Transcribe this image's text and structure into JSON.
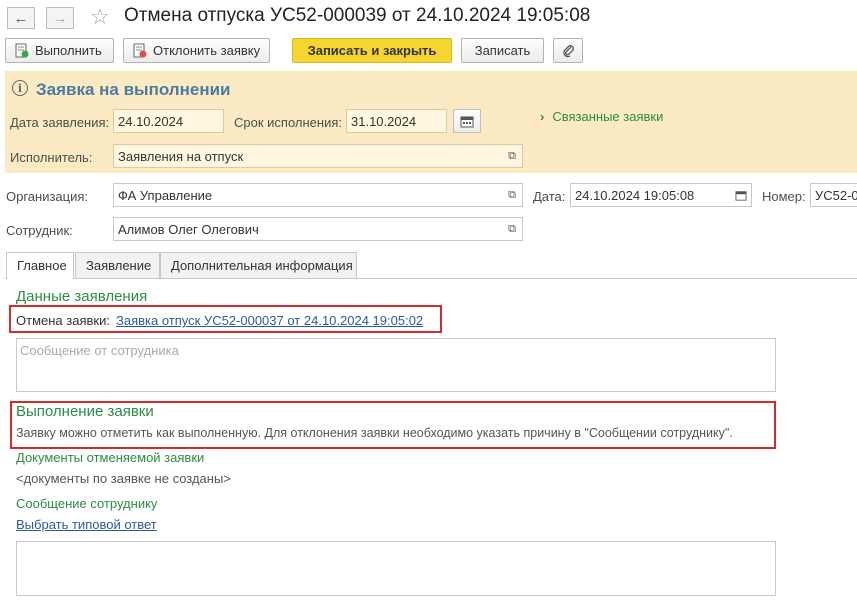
{
  "window": {
    "title": "Отмена отпуска УС52-000039 от 24.10.2024 19:05:08",
    "back_icon": "arrow-left-icon",
    "forward_icon": "arrow-right-icon",
    "favorite_icon": "star-icon"
  },
  "toolbar": {
    "execute_label": "Выполнить",
    "reject_label": "Отклонить заявку",
    "save_close_label": "Записать и закрыть",
    "save_label": "Записать",
    "attach_icon": "paperclip-icon"
  },
  "status": {
    "title": "Заявка на выполнении",
    "date_label": "Дата заявления:",
    "date_value": "24.10.2024",
    "deadline_label": "Срок исполнения:",
    "deadline_value": "31.10.2024",
    "related_label": "Связанные заявки",
    "executor_label": "Исполнитель:",
    "executor_value": "Заявления на отпуск"
  },
  "header": {
    "org_label": "Организация:",
    "org_value": "ФА Управление",
    "date_label": "Дата:",
    "date_value": "24.10.2024 19:05:08",
    "number_label": "Номер:",
    "number_value": "УС52-0",
    "employee_label": "Сотрудник:",
    "employee_value": "Алимов Олег Олегович"
  },
  "tabs": [
    {
      "label": "Главное",
      "active": true
    },
    {
      "label": "Заявление",
      "active": false
    },
    {
      "label": "Дополнительная информация",
      "active": false
    }
  ],
  "main": {
    "section_title": "Данные заявления",
    "cancel_label": "Отмена заявки:",
    "cancel_link": "Заявка отпуск УС52-000037 от 24.10.2024 19:05:02",
    "message_placeholder": "Сообщение от сотрудника",
    "execution_title": "Выполнение заявки",
    "execution_text": "Заявку можно отметить как выполненную. Для отклонения заявки необходимо указать причину в \"Сообщении сотруднику\".",
    "docs_title": "Документы отменяемой заявки",
    "docs_text": "<документы по заявке не созданы>",
    "reply_title": "Сообщение сотруднику",
    "reply_link": "Выбрать типовой ответ"
  },
  "colors": {
    "accent_yellow": "#f5d631",
    "status_bg": "#fbeac4",
    "green_heading": "#2e8b46",
    "status_title": "#4c7ca3",
    "highlight_red": "#d42a2a",
    "link_blue": "#2a5b9f"
  }
}
